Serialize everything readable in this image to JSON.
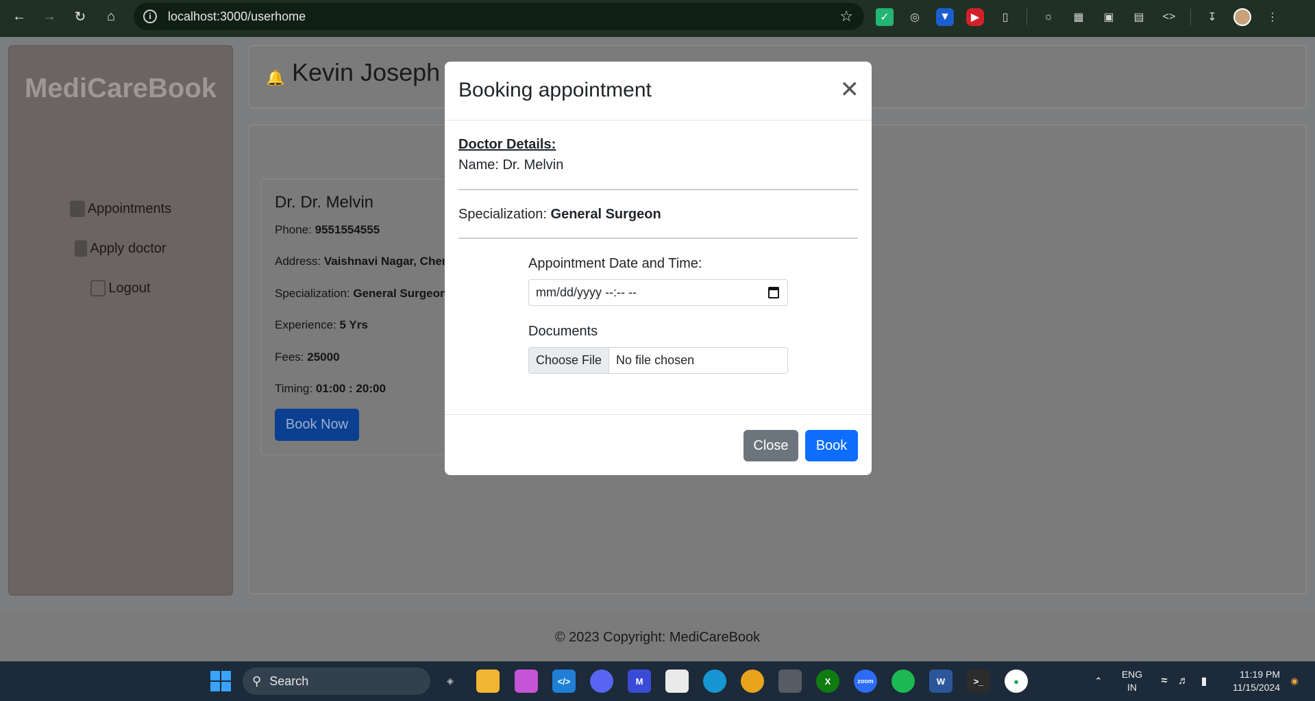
{
  "browser": {
    "url": "localhost:3000/userhome"
  },
  "app": {
    "brand": "MediCareBook",
    "user_name": "Kevin Joseph",
    "sidebar": {
      "items": [
        {
          "label": "Appointments",
          "icon": "calendar-icon"
        },
        {
          "label": "Apply doctor",
          "icon": "medical-doc-icon"
        },
        {
          "label": "Logout",
          "icon": "logout-icon"
        }
      ]
    },
    "doctor_card": {
      "title": "Dr. Dr. Melvin",
      "phone_label": "Phone:",
      "phone": "9551554555",
      "address_label": "Address:",
      "address": "Vaishnavi Nagar, Chennai",
      "specialization_label": "Specialization:",
      "specialization": "General Surgeon",
      "experience_label": "Experience:",
      "experience": "5 Yrs",
      "fees_label": "Fees:",
      "fees": "25000",
      "timing_label": "Timing:",
      "timing": "01:00 : 20:00",
      "book_label": "Book Now"
    },
    "footer": "© 2023 Copyright: MediCareBook"
  },
  "modal": {
    "title": "Booking appointment",
    "section_heading": "Doctor Details:",
    "name_line": "Name:  Dr. Melvin",
    "specialization_label": "Specialization:",
    "specialization": "General Surgeon",
    "date_label": "Appointment Date and Time:",
    "date_placeholder": "mm/dd/yyyy --:-- --",
    "documents_label": "Documents",
    "file_button": "Choose File",
    "file_status": "No file chosen",
    "close_label": "Close",
    "book_label": "Book"
  },
  "taskbar": {
    "search_placeholder": "Search",
    "lang_line1": "ENG",
    "lang_line2": "IN",
    "time": "11:19 PM",
    "date": "11/15/2024"
  },
  "colors": {
    "primary": "#0d6efd",
    "secondary": "#6c757d",
    "overlay": "#7c7d7e"
  }
}
